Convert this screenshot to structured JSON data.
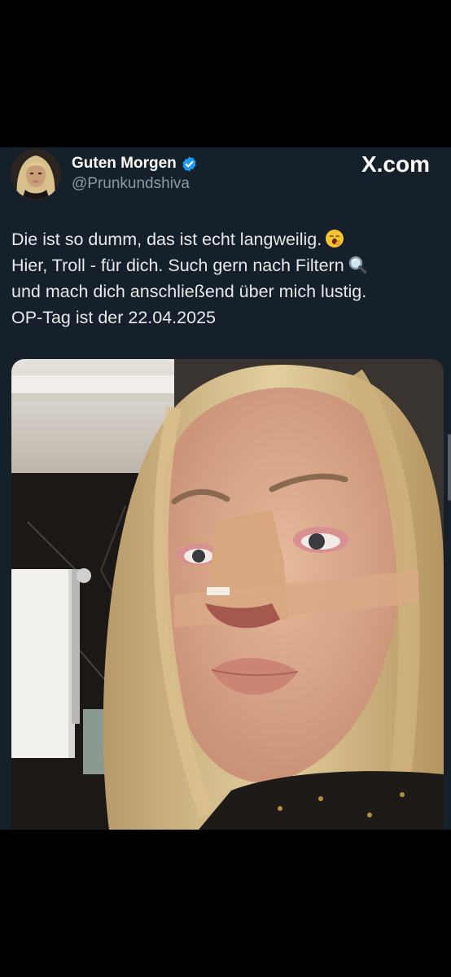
{
  "tweet": {
    "display_name": "Guten Morgen",
    "handle": "@Prunkundshiva",
    "verified": true,
    "brand": "X.com",
    "text_lines": [
      "Die ist so dumm, das ist echt langweilig.",
      "Hier, Troll - für dich. Such gern nach Filtern",
      "und mach dich anschließend über mich lustig.",
      "OP-Tag ist der 22.04.2025"
    ],
    "emojis": [
      "yawning-face-emoji",
      "magnifying-glass-emoji"
    ],
    "media": "photo"
  },
  "colors": {
    "background": "#000000",
    "card": "#15202b",
    "text": "#e7e9ea",
    "secondary_text": "#8b98a5",
    "verified": "#1d9bf0"
  }
}
